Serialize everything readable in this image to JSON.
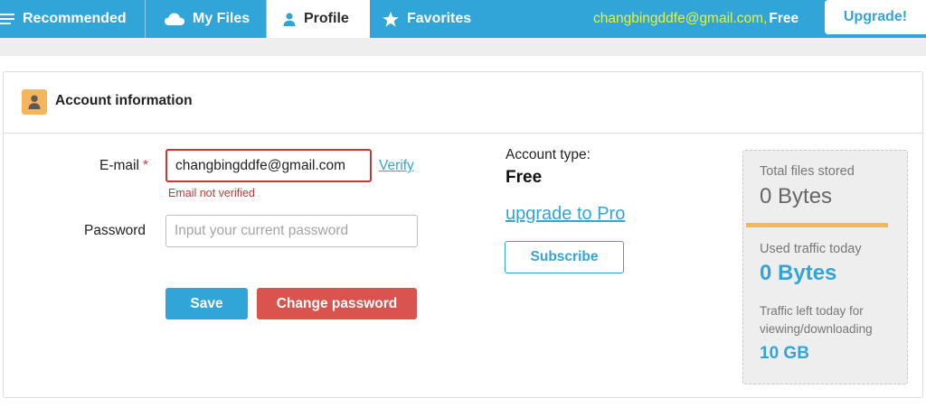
{
  "nav": {
    "tabs": [
      {
        "label": "Recommended",
        "icon": "list-icon"
      },
      {
        "label": "My Files",
        "icon": "cloud-icon"
      },
      {
        "label": "Profile",
        "icon": "user-icon",
        "active": true
      },
      {
        "label": "Favorites",
        "icon": "star-icon"
      }
    ],
    "account_email": "changbingddfe@gmail.com,",
    "account_plan": "Free",
    "upgrade_label": "Upgrade!"
  },
  "panel": {
    "title": "Account information",
    "icon": "user-icon"
  },
  "form": {
    "email_label": "E-mail",
    "required_mark": "*",
    "email_value": "changbingddfe@gmail.com",
    "verify_label": "Verify",
    "email_error": "Email not verified",
    "password_label": "Password",
    "password_placeholder": "Input your current password",
    "save_label": "Save",
    "change_password_label": "Change password"
  },
  "account": {
    "type_label": "Account type:",
    "type_value": "Free",
    "upgrade_link": "upgrade to Pro",
    "subscribe_label": "Subscribe"
  },
  "stats": {
    "total_files_label": "Total files stored",
    "total_files_value": "0 Bytes",
    "used_traffic_label": "Used traffic today",
    "used_traffic_value": "0 Bytes",
    "traffic_left_label_line1": "Traffic left today for",
    "traffic_left_label_line2": "viewing/downloading",
    "traffic_left_value": "10 GB"
  },
  "colors": {
    "brand": "#32a5d8",
    "account_email": "#e8f23a",
    "danger": "#d9534f",
    "header_icon_bg": "#f7b55b",
    "stats_bar": "#f5b75a"
  }
}
